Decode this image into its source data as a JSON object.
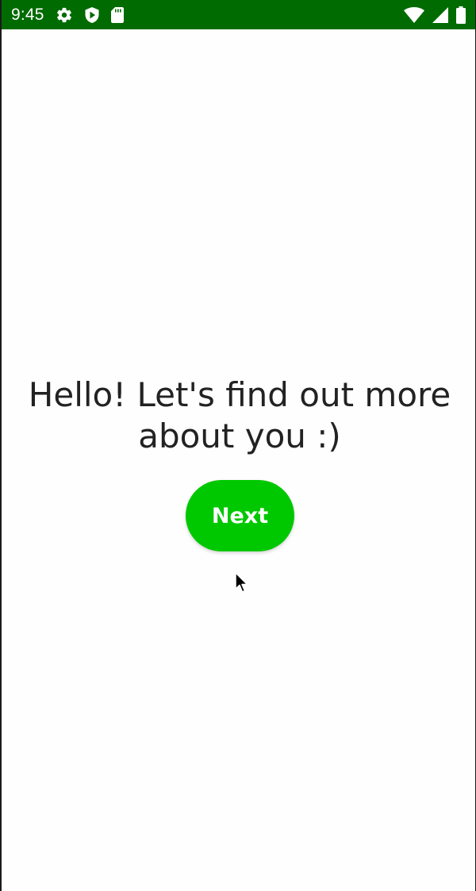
{
  "status_bar": {
    "time": "9:45",
    "background": "#006b00",
    "left_icons": [
      "gear-icon",
      "play-protect-icon",
      "sd-card-icon"
    ],
    "right_icons": [
      "wifi-icon",
      "cell-signal-icon",
      "battery-icon"
    ]
  },
  "main": {
    "greeting": "Hello! Let's find out more about you :)",
    "next_label": "Next",
    "accent_color": "#00c800"
  }
}
